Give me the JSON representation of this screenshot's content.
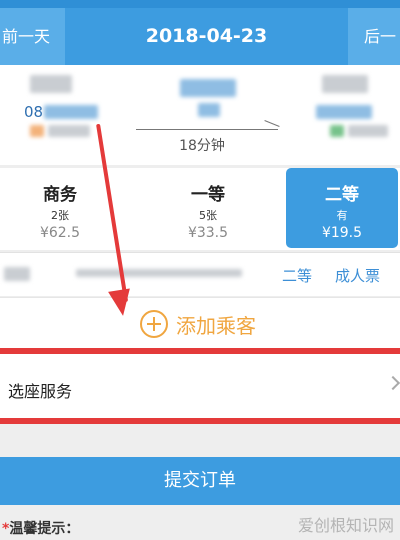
{
  "header": {
    "prev_day": "前一天",
    "date": "2018-04-23",
    "next_day": "后一"
  },
  "train": {
    "from_code_prefix": "08",
    "duration": "18分钟"
  },
  "seats": [
    {
      "name": "商务",
      "count": "2张",
      "price": "¥62.5",
      "selected": false
    },
    {
      "name": "一等",
      "count": "5张",
      "price": "¥33.5",
      "selected": false
    },
    {
      "name": "二等",
      "count": "有",
      "price": "¥19.5",
      "selected": true
    }
  ],
  "passenger": {
    "seat_class": "二等",
    "ticket_type": "成人票"
  },
  "add_passenger_label": "添加乘客",
  "seat_service_label": "选座服务",
  "submit_label": "提交订单",
  "tips_star": "*",
  "tips_label": "温馨提示：",
  "watermark": "爱创根知识网",
  "colors": {
    "primary_blue": "#3d9ce0",
    "accent_orange": "#f0a640",
    "highlight_red": "#e43a3a"
  }
}
